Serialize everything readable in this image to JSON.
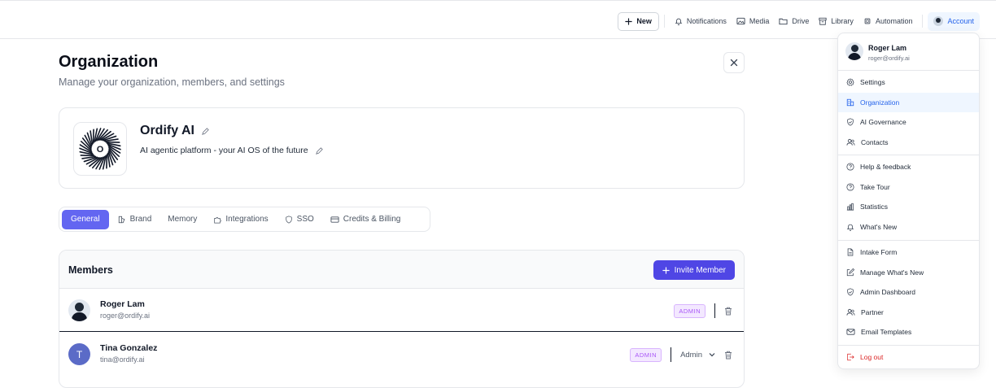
{
  "topbar": {
    "new_label": "New",
    "nav": [
      {
        "label": "Notifications",
        "icon": "bell-icon"
      },
      {
        "label": "Media",
        "icon": "image-icon"
      },
      {
        "label": "Drive",
        "icon": "folder-icon"
      },
      {
        "label": "Library",
        "icon": "archive-icon"
      },
      {
        "label": "Automation",
        "icon": "chip-icon"
      }
    ],
    "account_label": "Account"
  },
  "page": {
    "title": "Organization",
    "subtitle": "Manage your organization, members, and settings"
  },
  "org": {
    "logo_letter": "O",
    "name": "Ordify AI",
    "tagline": "AI agentic platform - your AI OS of the future"
  },
  "tabs": [
    {
      "label": "General",
      "icon": "",
      "active": true
    },
    {
      "label": "Brand",
      "icon": "brand-icon"
    },
    {
      "label": "Memory",
      "icon": ""
    },
    {
      "label": "Integrations",
      "icon": "puzzle-icon"
    },
    {
      "label": "SSO",
      "icon": "shield-icon"
    },
    {
      "label": "Credits & Billing",
      "icon": "credit-card-icon"
    }
  ],
  "members": {
    "title": "Members",
    "invite_label": "Invite Member",
    "rows": [
      {
        "name": "Roger Lam",
        "email": "roger@ordify.ai",
        "badge": "ADMIN",
        "role": ""
      },
      {
        "name": "Tina Gonzalez",
        "email": "tina@ordify.ai",
        "badge": "ADMIN",
        "role": "Admin",
        "initial": "T"
      }
    ]
  },
  "account_menu": {
    "user_name": "Roger Lam",
    "user_email": "roger@ordify.ai",
    "items": [
      {
        "label": "Settings",
        "icon": "gear-icon"
      },
      {
        "label": "Organization",
        "icon": "building-icon",
        "active": true
      },
      {
        "label": "AI Governance",
        "icon": "shield-check-icon"
      },
      {
        "label": "Contacts",
        "icon": "users-icon"
      },
      {
        "label": "Help & feedback",
        "icon": "help-circle-icon"
      },
      {
        "label": "Take Tour",
        "icon": "help-circle-icon"
      },
      {
        "label": "Statistics",
        "icon": "bar-chart-icon"
      },
      {
        "label": "What's New",
        "icon": "bell-icon"
      },
      {
        "label": "Intake Form",
        "icon": "file-icon"
      },
      {
        "label": "Manage What's New",
        "icon": "edit-icon"
      },
      {
        "label": "Admin Dashboard",
        "icon": "shield-check-icon"
      },
      {
        "label": "Partner",
        "icon": "users-icon"
      },
      {
        "label": "Email Templates",
        "icon": "mail-icon"
      },
      {
        "label": "Log out",
        "icon": "logout-icon"
      }
    ]
  },
  "colors": {
    "primary": "#4f46e5",
    "tab_active": "#6366f1",
    "menu_active_bg": "#eff6ff",
    "menu_active_text": "#2563eb",
    "danger": "#dc2626",
    "badge_text": "#a855f7"
  }
}
